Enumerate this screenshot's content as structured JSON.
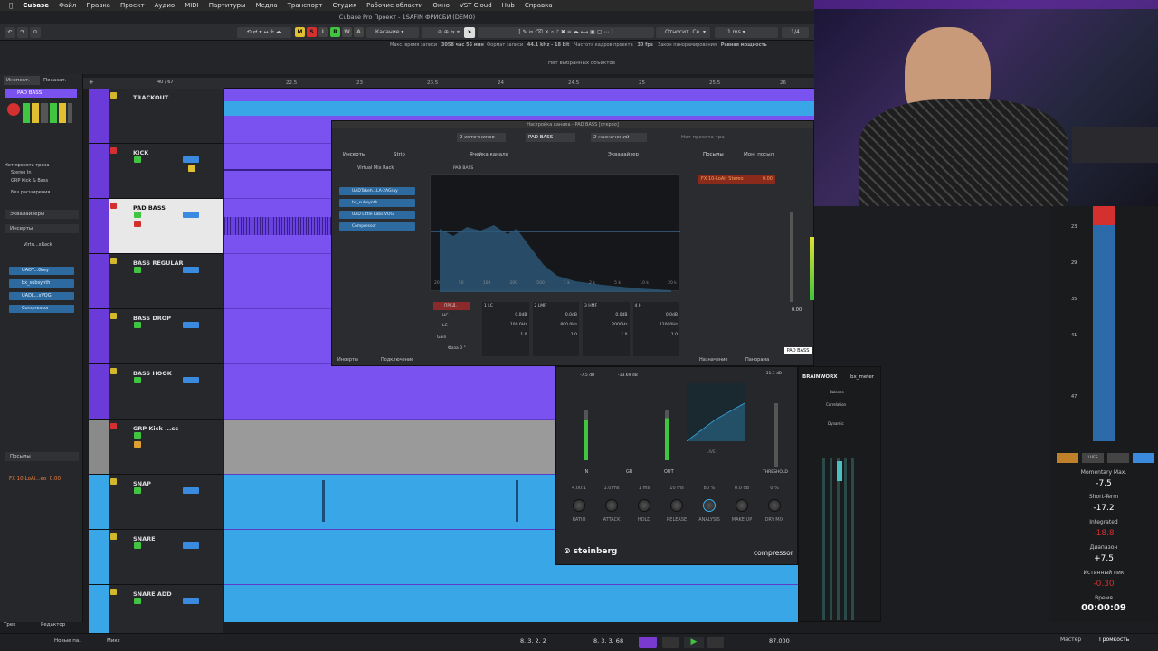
{
  "menubar": {
    "items": [
      "Cubase",
      "Файл",
      "Правка",
      "Проект",
      "Аудио",
      "MIDI",
      "Партитуры",
      "Медиа",
      "Транспорт",
      "Студия",
      "Рабочие области",
      "Окно",
      "VST Cloud",
      "Hub",
      "Справка"
    ]
  },
  "window": {
    "title": "Cubase Pro Проект - 1SAFIN ФРИСБИ (DEMO)"
  },
  "toolbar": {
    "m": "M",
    "s": "S",
    "l": "L",
    "r": "R",
    "w": "W",
    "a": "A",
    "automation_mode": "Касание",
    "snap_mode": "Относит. Се.",
    "quantize": "1 ms",
    "zoom_ratio": "1/4"
  },
  "status_line": {
    "max_rec_time_label": "Макс. время записи",
    "max_rec_time": "3058 час 55 мин",
    "rec_format_label": "Формат записи",
    "rec_format": "44.1 kHz - 18 bit",
    "fps_label": "Частота кадров проекта",
    "fps": "30 fps",
    "pan_law_label": "Закон панорамирования",
    "pan_law": "Равная мощность",
    "no_selection": "Нет выбранных объектов"
  },
  "inspector": {
    "tabs": [
      "Инспект.",
      "Показат."
    ],
    "track_name": "PAD BASS",
    "routing_none": "Нет пресета трека",
    "stereo_in": "Stereo In",
    "group": "GRP Kick & Bass",
    "extensions": "Без расширения",
    "equalizers": "Эквалайзеры",
    "inserts": "Инсерты",
    "rack": "Virtu...xRack",
    "insert_slots": [
      "UADT...Grey",
      "bx_subsynth",
      "UADL...xVOG",
      "Compressor"
    ],
    "sends": "Посылы",
    "send_fx": "FX 10-LoAi...eo",
    "send_val": "0.00",
    "bottom_tabs": [
      "Трек",
      "Редактор"
    ]
  },
  "ruler": {
    "marks": [
      "22.5",
      "23",
      "23.5",
      "24",
      "24.5",
      "25",
      "25.5",
      "26"
    ],
    "counter": "40 / 67"
  },
  "tracks": [
    {
      "name": "TRACKOUT"
    },
    {
      "name": "KICK"
    },
    {
      "name": "PAD BASS"
    },
    {
      "name": "BASS REGULAR"
    },
    {
      "name": "BASS DROP"
    },
    {
      "name": "BASS HOOK"
    },
    {
      "name": "GRP Kick ...ss"
    },
    {
      "name": "SNAP"
    },
    {
      "name": "SNARE"
    },
    {
      "name": "SNARE ADD"
    }
  ],
  "mixer_window": {
    "title": "Настройка канала - PAD BASS [стерео]",
    "sources": "2 источников",
    "channel": "PAD BASS",
    "destinations": "2 назначений",
    "no_preset": "Нет пресета тра",
    "tabs_left": [
      "Инсерты",
      "Strip"
    ],
    "cell_label": "Ячейка канала",
    "eq_label": "Эквалайзер",
    "tabs_right": [
      "Посылы",
      "Мон. посыл"
    ],
    "rack": "Virtual Mix Rack",
    "inserts": [
      "UADTakeh...LA-2AGray",
      "bx_subsynth",
      "UAD Little Labs VOG",
      "Compressor"
    ],
    "pad": "PAD BASS",
    "send_fx": "FX 10-LoAir Stereo",
    "send_val": "0.00",
    "bottom_left": [
      "Инсерты",
      "Подключение"
    ],
    "bottom_right": [
      "Назначение",
      "Панорама"
    ],
    "eq_freq_labels": [
      "20",
      "50",
      "100",
      "200",
      "500",
      "1 k",
      "2 k",
      "5 k",
      "10 k",
      "20 k"
    ],
    "pre": "ПРЕД.",
    "hc": "HC",
    "lc": "LC",
    "gain": "Gain",
    "phase": "Фаза 0 °",
    "bands": [
      {
        "name": "1 LC",
        "gain": "0.0dB",
        "freq": "100.0Hz",
        "q": "1.0"
      },
      {
        "name": "2 LMF",
        "gain": "0.0dB",
        "freq": "800.0Hz",
        "q": "1.0"
      },
      {
        "name": "3 HMF",
        "gain": "0.0dB",
        "freq": "2000Hz",
        "q": "1.0"
      },
      {
        "name": "4 H",
        "gain": "0.0dB",
        "freq": "12000Hz",
        "q": "1.0"
      }
    ],
    "fader_value": "0.00",
    "fader_label": "PAD BASS",
    "fader_peak": "-7.5"
  },
  "compressor": {
    "in_val": "-7.5 dB",
    "gr_val": "-13.69 dB",
    "out_val": "-31.1 dB",
    "meter_labels": [
      "IN",
      "GR",
      "OUT"
    ],
    "live": "LIVE",
    "threshold_label": "THRESHOLD",
    "knobs": [
      {
        "value": "4.00:1",
        "label": "RATIO"
      },
      {
        "value": "1.0 ms",
        "label": "ATTACK"
      },
      {
        "value": "1 ms",
        "label": "HOLD"
      },
      {
        "value": "10 ms",
        "label": "RELEASE"
      },
      {
        "value": "80 %",
        "label": "ANALYSIS"
      },
      {
        "value": "0.0 dB",
        "label": "MAKE UP"
      },
      {
        "value": "0 %",
        "label": "DRY MIX"
      }
    ],
    "brand": "steinberg",
    "product": "compressor"
  },
  "bx_meter": {
    "brand": "BRAINWORX",
    "name": "bx_meter",
    "balance": "Balance",
    "correlation": "Correlation",
    "dynamic": "Dynamic"
  },
  "loudness": {
    "scale": [
      "23",
      "29",
      "35",
      "41",
      "47"
    ],
    "momentary_label": "Momentary Max.",
    "momentary": "-7.5",
    "shortterm_label": "Short-Term",
    "shortterm": "-17.2",
    "integrated_label": "Integrated",
    "integrated": "-18.8",
    "range_label": "Диапазон",
    "range": "+7.5",
    "truepeak_label": "Истинный пик",
    "truepeak": "-0.30",
    "time_label": "Время",
    "time": "00:00:09",
    "unit": "LUFS",
    "bottom_tabs": [
      "Мастер",
      "Громкость"
    ]
  },
  "transport": {
    "left_pos": "8. 3. 2. 2",
    "right_pos": "8. 3. 3. 68",
    "tempo": "87.000",
    "new_part": "Новые па.",
    "mix": "Микс"
  },
  "colors": {
    "track_purple": "#7a52f0",
    "track_blue": "#39a6e8",
    "accent": "#3ab0f0",
    "green": "#3fc53f",
    "red": "#d43030",
    "yellow": "#d4b82c"
  }
}
